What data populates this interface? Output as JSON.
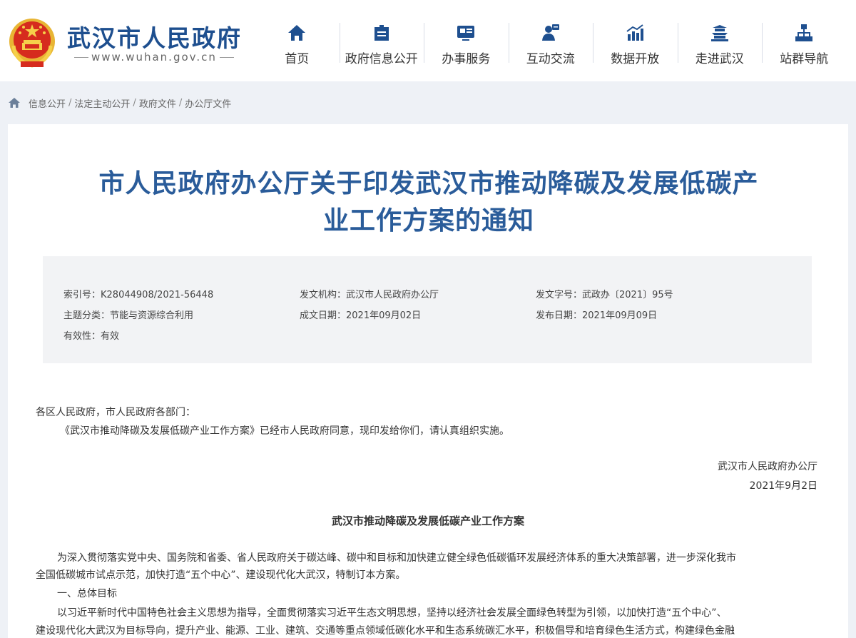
{
  "header": {
    "site_title": "武汉市人民政府",
    "site_url": "www.wuhan.gov.cn",
    "nav": [
      {
        "label": "首页",
        "icon": "home-icon"
      },
      {
        "label": "政府信息公开",
        "icon": "document-icon"
      },
      {
        "label": "办事服务",
        "icon": "service-icon"
      },
      {
        "label": "互动交流",
        "icon": "interaction-icon"
      },
      {
        "label": "数据开放",
        "icon": "chart-icon"
      },
      {
        "label": "走进武汉",
        "icon": "tower-icon"
      },
      {
        "label": "站群导航",
        "icon": "sitemap-icon"
      }
    ]
  },
  "breadcrumb": [
    "信息公开",
    "法定主动公开",
    "政府文件",
    "办公厅文件"
  ],
  "document": {
    "title_line1": "市人民政府办公厅关于印发武汉市推动降碳及发展低碳产",
    "title_line2": "业工作方案的通知",
    "meta": {
      "index_label": "索引号：",
      "index_value": "K28044908/2021-56448",
      "issuer_label": "发文机构：",
      "issuer_value": "武汉市人民政府办公厅",
      "docno_label": "发文字号：",
      "docno_value": "武政办〔2021〕95号",
      "topic_label": "主题分类：",
      "topic_value": "节能与资源综合利用",
      "written_label": "成文日期：",
      "written_value": "2021年09月02日",
      "published_label": "发布日期：",
      "published_value": "2021年09月09日",
      "validity_label": "有效性：",
      "validity_value": "有效"
    },
    "salutation": "各区人民政府，市人民政府各部门：",
    "intro": "《武汉市推动降碳及发展低碳产业工作方案》已经市人民政府同意，现印发给你们，请认真组织实施。",
    "signature": "武汉市人民政府办公厅",
    "date": "2021年9月2日",
    "plan_title": "武汉市推动降碳及发展低碳产业工作方案",
    "para1_line1": "为深入贯彻落实党中央、国务院和省委、省人民政府关于碳达峰、碳中和目标和加快建立健全绿色低碳循环发展经济体系的重大决策部署，进一步深化我市",
    "para1_line2": "全国低碳城市试点示范，加快打造“五个中心”、建设现代化大武汉，特制订本方案。",
    "section1": "一、总体目标",
    "para2_line1": "以习近平新时代中国特色社会主义思想为指导，全面贯彻落实习近平生态文明思想，坚持以经济社会发展全面绿色转型为引领，以加快打造“五个中心”、",
    "para2_line2": "建设现代化大武汉为目标导向，提升产业、能源、工业、建筑、交通等重点领域低碳化水平和生态系统碳汇水平，积极倡导和培育绿色生活方式，构建绿色金融"
  }
}
